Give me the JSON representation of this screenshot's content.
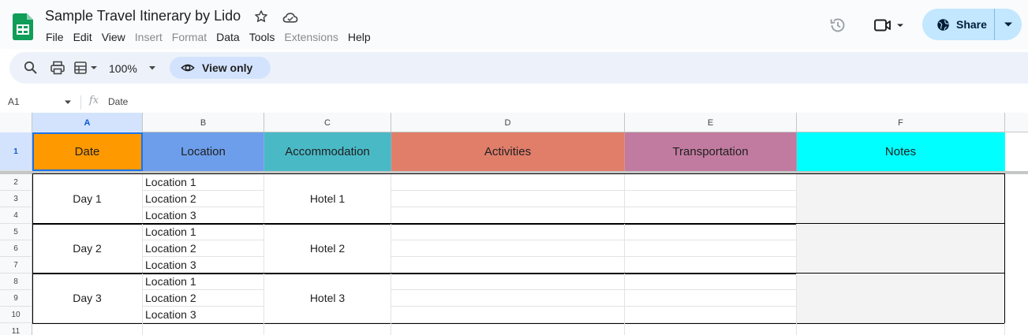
{
  "app": {
    "title": "Sample Travel Itinerary by Lido",
    "menu": [
      {
        "label": "File",
        "enabled": true
      },
      {
        "label": "Edit",
        "enabled": true
      },
      {
        "label": "View",
        "enabled": true
      },
      {
        "label": "Insert",
        "enabled": false
      },
      {
        "label": "Format",
        "enabled": false
      },
      {
        "label": "Data",
        "enabled": true
      },
      {
        "label": "Tools",
        "enabled": true
      },
      {
        "label": "Extensions",
        "enabled": false
      },
      {
        "label": "Help",
        "enabled": true
      }
    ],
    "share_label": "Share"
  },
  "toolbar": {
    "zoom": "100%",
    "view_only_label": "View only"
  },
  "formula_bar": {
    "cell_ref": "A1",
    "fx": "fx",
    "value": "Date"
  },
  "sheet": {
    "columns": [
      "A",
      "B",
      "C",
      "D",
      "E",
      "F"
    ],
    "rows": [
      "1",
      "2",
      "3",
      "4",
      "5",
      "6",
      "7",
      "8",
      "9",
      "10",
      "11"
    ],
    "headers": [
      "Date",
      "Location",
      "Accommodation",
      "Activities",
      "Transportation",
      "Notes"
    ],
    "header_colors": [
      "#ff9900",
      "#6d9eeb",
      "#4ab9c6",
      "#e07e6a",
      "#c27ba0",
      "#00ffff"
    ],
    "notes_fill": "#f3f3f3",
    "days": [
      {
        "date": "Day 1",
        "locations": [
          "Location 1",
          "Location 2",
          "Location 3"
        ],
        "hotel": "Hotel 1"
      },
      {
        "date": "Day 2",
        "locations": [
          "Location 1",
          "Location 2",
          "Location 3"
        ],
        "hotel": "Hotel 2"
      },
      {
        "date": "Day 3",
        "locations": [
          "Location 1",
          "Location 2",
          "Location 3"
        ],
        "hotel": "Hotel 3"
      }
    ]
  },
  "colors": {
    "share_bg": "#c2e7ff",
    "toolbar_bg": "#edf2fa",
    "view_only_bg": "#d3e3fd",
    "selection": "#1a73e8"
  },
  "icons": [
    "sheets-logo-icon",
    "star-icon",
    "cloud-status-icon",
    "history-icon",
    "meet-icon",
    "globe-icon",
    "search-icon",
    "print-icon",
    "format-icon",
    "eye-icon"
  ]
}
